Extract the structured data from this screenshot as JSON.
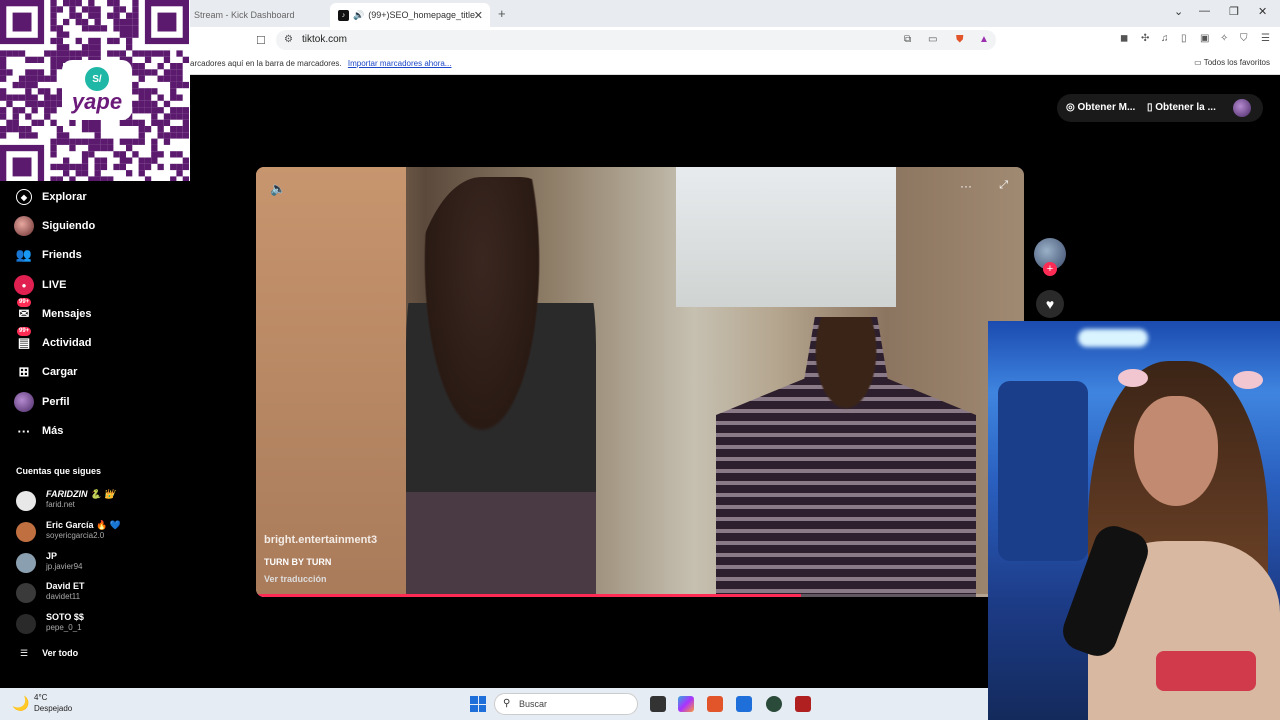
{
  "browser": {
    "tabs": [
      {
        "title": "Stream - Kick Dashboard",
        "active": false
      },
      {
        "title": "(99+)SEO_homepage_title",
        "active": true
      }
    ],
    "url": "tiktok.com",
    "bookmarks_bar": {
      "text": "arcadores aquí en la barra de marcadores.",
      "import_link": "Importar marcadores ahora...",
      "favorites_label": "Todos los favoritos"
    },
    "icons": [
      "bookmark-icon",
      "site-info-icon",
      "translate-icon",
      "cast-icon",
      "brave-shield-icon",
      "brave-rewards-icon",
      "extension-icons",
      "sidebar-icon",
      "wallet-icon",
      "vpn-icon",
      "menu-icon"
    ]
  },
  "header": {
    "buttons": [
      {
        "label": "Obtener M...",
        "icon": "coin-icon"
      },
      {
        "label": "Obtener la ...",
        "icon": "phone-icon"
      }
    ]
  },
  "qr_overlay": {
    "brand": "yape",
    "currency_symbol": "S/"
  },
  "sidebar": {
    "nav": [
      {
        "label": "Explorar",
        "icon": "compass-icon"
      },
      {
        "label": "Siguiendo",
        "icon": "avatar"
      },
      {
        "label": "Friends",
        "icon": "friends-icon"
      },
      {
        "label": "LIVE",
        "icon": "live-icon"
      },
      {
        "label": "Mensajes",
        "icon": "messages-icon",
        "badge": "99+"
      },
      {
        "label": "Actividad",
        "icon": "activity-icon",
        "badge": "99+"
      },
      {
        "label": "Cargar",
        "icon": "upload-icon"
      },
      {
        "label": "Perfil",
        "icon": "profile-avatar"
      },
      {
        "label": "Más",
        "icon": "more-icon"
      }
    ],
    "following_title": "Cuentas que sigues",
    "accounts": [
      {
        "name": "FARIDZIN 🐍 👑",
        "handle": "farid.net",
        "color": "#e8e8e8"
      },
      {
        "name": "Eric García 🔥 💙",
        "handle": "soyericgarcia2.0",
        "color": "#c07040"
      },
      {
        "name": "JP",
        "handle": "jp.javier94",
        "color": "#8aa0b0"
      },
      {
        "name": "David ET",
        "handle": "davidet11",
        "color": "#3a3a3a"
      },
      {
        "name": "SOTO $$",
        "handle": "pepe_0_1",
        "color": "#2a2a2a"
      }
    ],
    "see_all": "Ver todo"
  },
  "video": {
    "author": "bright.entertainment3",
    "description": "TURN BY TURN",
    "translate": "Ver traducción",
    "progress": 0.71
  },
  "taskbar": {
    "weather_temp": "4°C",
    "weather_desc": "Despejado",
    "search_placeholder": "Buscar"
  }
}
